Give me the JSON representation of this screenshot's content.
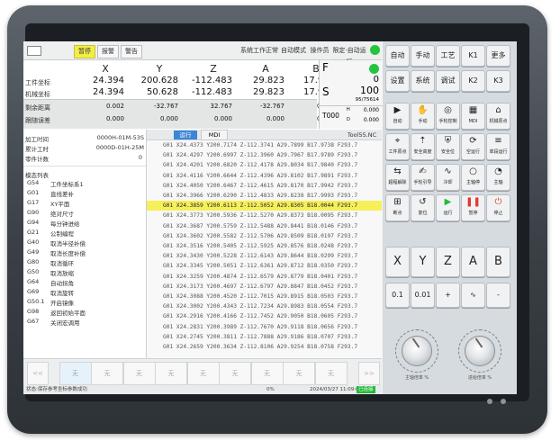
{
  "topbar": {
    "btn1": "暂停",
    "btn2": "报警",
    "btn3": "警告",
    "mode_label": "系统工作正常",
    "auto_mode": "自动模式",
    "op_label": "操作员",
    "speed_label": "限定·自动运行"
  },
  "axes": {
    "headers": [
      "X",
      "Y",
      "Z",
      "A",
      "B"
    ],
    "work_label": "工件坐标",
    "machine_label": "机械坐标",
    "remain_label": "剩余距离",
    "follow_label": "跟随误差",
    "work": [
      "24.394",
      "200.628",
      "-112.483",
      "29.823",
      "17.999"
    ],
    "machine": [
      "24.394",
      "50.628",
      "-112.483",
      "29.823",
      "17.999"
    ],
    "remain": [
      "0.002",
      "-32.767",
      "32.767",
      "-32.767",
      "0.000"
    ],
    "follow": [
      "0.000",
      "0.000",
      "0.000",
      "0.000",
      "0.000"
    ]
  },
  "fs": {
    "f_label": "F",
    "f_value": "0",
    "s_label": "S",
    "s_value": "100",
    "s_sub": "95/75614",
    "t_label": "T000",
    "h_label": "H",
    "h_value": "0.000",
    "d_label": "D",
    "d_value": "0.000"
  },
  "info": {
    "run_time_label": "加工时间",
    "run_time": "0000H-01M-53S",
    "total_time_label": "累计工时",
    "total_time": "0000D-01H-25M",
    "count_label": "零件计数",
    "count": "0",
    "modal_title": "模态列表",
    "modal": [
      [
        "G54",
        "工件坐标系1"
      ],
      [
        "G01",
        "直线差补"
      ],
      [
        "G17",
        "XY平面"
      ],
      [
        "G90",
        "绝对尺寸"
      ],
      [
        "G94",
        "每分钟进给"
      ],
      [
        "G21",
        "公制编程"
      ],
      [
        "G40",
        "取消半径补偿"
      ],
      [
        "G49",
        "取消长度补偿"
      ],
      [
        "G80",
        "取消循环"
      ],
      [
        "G50",
        "取消放缩"
      ],
      [
        "G64",
        "自动拐角"
      ],
      [
        "G69",
        "取消旋转"
      ],
      [
        "G50.1",
        "开启镜像"
      ],
      [
        "G98",
        "返回初始平面"
      ],
      [
        "G67",
        "关闭宏调用"
      ]
    ]
  },
  "program": {
    "tab_run": "运行",
    "tab_mdi": "MDI",
    "tool_label": "Tool55.NC",
    "lines": [
      "G01 X24.4373 Y200.7174 Z-112.3741 A29.7899 B17.9738 F293.7",
      "G01 X24.4297 Y200.6997 Z-112.3960 A29.7967 B17.9789 F293.7",
      "G01 X24.4201 Y200.6820 Z-112.4178 A29.8034 B17.9840 F293.7",
      "G01 X24.4116 Y200.6644 Z-112.4396 A29.8102 B17.9891 F293.7",
      "G01 X24.4050 Y200.6467 Z-112.4615 A29.8170 B17.9942 F293.7",
      "G01 X24.3966 Y200.6290 Z-112.4833 A29.8238 B17.9993 F293.7",
      "G01 X24.3859 Y200.6113 Z-112.5052 A29.8305 B18.0044 F293.7",
      "G01 X24.3773 Y200.5936 Z-112.5270 A29.8373 B18.0095 F293.7",
      "G01 X24.3687 Y200.5759 Z-112.5488 A29.8441 B18.0146 F293.7",
      "G01 X24.3602 Y200.5582 Z-112.5706 A29.8509 B18.0197 F293.7",
      "G01 X24.3516 Y200.5405 Z-112.5925 A29.8576 B18.0248 F293.7",
      "G01 X24.3430 Y200.5228 Z-112.6143 A29.8644 B18.0299 F293.7",
      "G01 X24.3345 Y200.5051 Z-112.6361 A29.8712 B18.0350 F293.7",
      "G01 X24.3259 Y200.4874 Z-112.6579 A29.8779 B18.0401 F293.7",
      "G01 X24.3173 Y200.4697 Z-112.6797 A29.8847 B18.0452 F293.7",
      "G01 X24.3088 Y200.4520 Z-112.7015 A29.8915 B18.0503 F293.7",
      "G01 X24.3002 Y200.4343 Z-112.7234 A29.8983 B18.0554 F293.7",
      "G01 X24.2916 Y200.4166 Z-112.7452 A29.9050 B18.0605 F293.7",
      "G01 X24.2831 Y200.3989 Z-112.7670 A29.9118 B18.0656 F293.7",
      "G01 X24.2745 Y200.3811 Z-112.7888 A29.9186 B18.0707 F293.7",
      "G01 X24.2659 Y200.3634 Z-112.8106 A29.9254 B18.0758 F293.7"
    ]
  },
  "softkeys": [
    "<<",
    "无",
    "无",
    "无",
    "无",
    "无",
    "无",
    "无",
    "无",
    "无",
    ">>"
  ],
  "status": {
    "message": "状态:保存参考坐标参数成功",
    "percent": "0%",
    "datetime": "2024/03/27 11:09:05",
    "conn": "已连接"
  },
  "keys": {
    "row1": [
      "自动",
      "手动",
      "工艺",
      "K1",
      "更多"
    ],
    "row2": [
      "设置",
      "系统",
      "调试",
      "K2",
      "K3"
    ],
    "icons_row1": [
      "自动",
      "手动",
      "手轮控制",
      "MDI",
      "机械原点"
    ],
    "icons_row2": [
      "工件原点",
      "安全高度",
      "安全位",
      "空运行",
      "单段运行"
    ],
    "icons_row3": [
      "超程解除",
      "手轮引导",
      "冷却",
      "主轴停",
      "主轴"
    ],
    "icons_row4": [
      "断点",
      "复位",
      "运行",
      "暂停",
      "停止"
    ],
    "axis_keys": [
      "X",
      "Y",
      "Z",
      "A",
      "B"
    ],
    "step_keys": [
      "0.1",
      "0.01",
      "+",
      "∿",
      "-"
    ],
    "knob1_label": "主轴倍率 %",
    "knob2_label": "进给倍率 %"
  },
  "colors": {
    "highlight": "#f6ef5a",
    "tab_active": "#3b86d6",
    "run_green": "#22b83a",
    "pause_red": "#e23a2f",
    "gauge_green": "#25c43f"
  }
}
